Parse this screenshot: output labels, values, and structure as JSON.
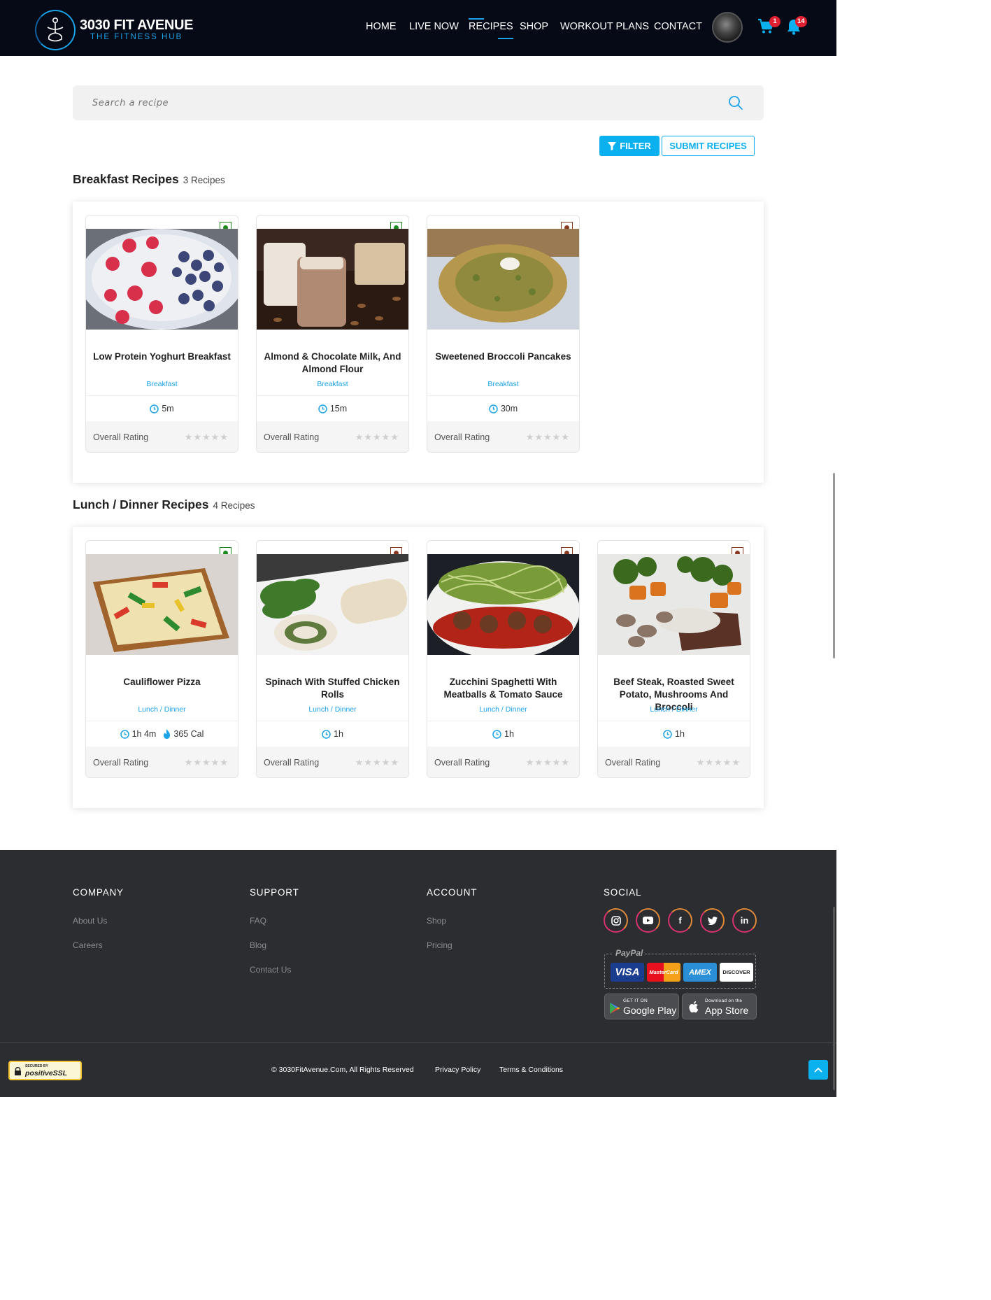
{
  "brand": {
    "name": "3030 FIT AVENUE",
    "tagline": "THE FITNESS HUB"
  },
  "nav": {
    "items": [
      "HOME",
      "LIVE NOW",
      "RECIPES",
      "SHOP",
      "WORKOUT PLANS",
      "CONTACT"
    ],
    "active": "RECIPES"
  },
  "header": {
    "cart_count": "1",
    "notification_count": "14"
  },
  "search": {
    "placeholder": "Search a recipe",
    "value": ""
  },
  "actions": {
    "filter_label": "FILTER",
    "submit_label": "SUBMIT RECIPES"
  },
  "rating_label": "Overall Rating",
  "sections": [
    {
      "title": "Breakfast Recipes",
      "count": "3 Recipes",
      "recipes": [
        {
          "title": "Low Protein Yoghurt Breakfast",
          "category": "Breakfast",
          "time": "5m",
          "calories": "",
          "diet": "veg",
          "stars": 0
        },
        {
          "title": "Almond & Chocolate Milk, And Almond Flour",
          "category": "Breakfast",
          "time": "15m",
          "calories": "",
          "diet": "veg",
          "stars": 0
        },
        {
          "title": "Sweetened Broccoli Pancakes",
          "category": "Breakfast",
          "time": "30m",
          "calories": "",
          "diet": "non-veg",
          "stars": 0
        }
      ]
    },
    {
      "title": "Lunch / Dinner Recipes",
      "count": "4 Recipes",
      "recipes": [
        {
          "title": "Cauliflower Pizza",
          "category": "Lunch / Dinner",
          "time": "1h 4m",
          "calories": "365 Cal",
          "diet": "veg",
          "stars": 0
        },
        {
          "title": "Spinach With Stuffed Chicken Rolls",
          "category": "Lunch / Dinner",
          "time": "1h",
          "calories": "",
          "diet": "non-veg",
          "stars": 0
        },
        {
          "title": "Zucchini Spaghetti With Meatballs & Tomato Sauce",
          "category": "Lunch / Dinner",
          "time": "1h",
          "calories": "",
          "diet": "non-veg",
          "stars": 0
        },
        {
          "title": "Beef Steak, Roasted Sweet Potato, Mushrooms And Broccoli",
          "category": "Lunch / Dinner",
          "time": "1h",
          "calories": "",
          "diet": "non-veg",
          "stars": 0
        }
      ]
    }
  ],
  "footer": {
    "columns": [
      {
        "heading": "COMPANY",
        "links": [
          "About Us",
          "Careers"
        ]
      },
      {
        "heading": "SUPPORT",
        "links": [
          "FAQ",
          "Blog",
          "Contact Us"
        ]
      },
      {
        "heading": "ACCOUNT",
        "links": [
          "Shop",
          "Pricing"
        ]
      }
    ],
    "social_heading": "SOCIAL",
    "social": [
      "instagram-icon",
      "youtube-icon",
      "facebook-icon",
      "twitter-icon",
      "linkedin-icon"
    ],
    "payment_label": "PayPal",
    "payment_cards": [
      "VISA",
      "MasterCard",
      "AMEX",
      "DISCOVER"
    ],
    "stores": [
      {
        "small": "GET IT ON",
        "big": "Google Play"
      },
      {
        "small": "Download on the",
        "big": "App Store"
      }
    ],
    "ssl_badge": {
      "small": "SECURED BY",
      "big": "positiveSSL"
    },
    "copyright": "© 3030FitAvenue.Com, All Rights Reserved",
    "privacy": "Privacy Policy",
    "terms": "Terms & Conditions"
  },
  "colors": {
    "header_bg": "#060a16",
    "accent": "#0bb0ee",
    "footer_bg": "#2b2d31",
    "veg": "#1a8a1a",
    "nonveg": "#8a3a22"
  }
}
